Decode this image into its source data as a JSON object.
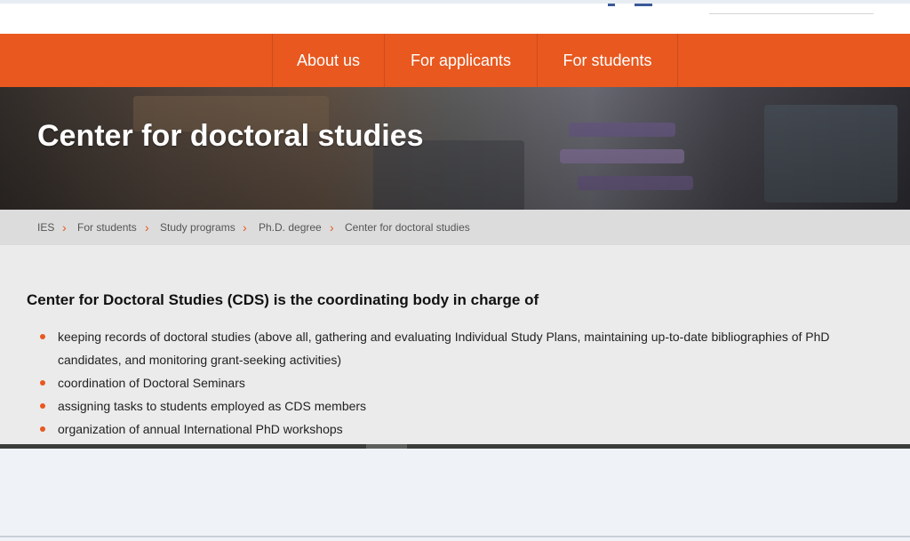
{
  "nav": {
    "items": [
      {
        "label": "About us"
      },
      {
        "label": "For applicants"
      },
      {
        "label": "For students"
      }
    ]
  },
  "hero": {
    "title": "Center for doctoral studies"
  },
  "breadcrumb": {
    "items": [
      "IES",
      "For students",
      "Study programs",
      "Ph.D. degree",
      "Center for doctoral studies"
    ],
    "separator": "›"
  },
  "main": {
    "heading": "Center for Doctoral Studies (CDS) is the coordinating body in charge of",
    "list": [
      {
        "text": "keeping records of doctoral studies (above all, gathering and evaluating Individual Study Plans, maintaining up-to-date bibliographies of PhD candidates, and monitoring grant-seeking activities)"
      },
      {
        "text": "coordination of Doctoral Seminars"
      },
      {
        "text": "assigning tasks to students employed as CDS members"
      },
      {
        "text": "organization of annual International PhD workshops"
      }
    ]
  },
  "colors": {
    "accent": "#e8581f",
    "breadcrumb_bg": "#dcdcdc",
    "content_bg": "#ebebeb"
  }
}
